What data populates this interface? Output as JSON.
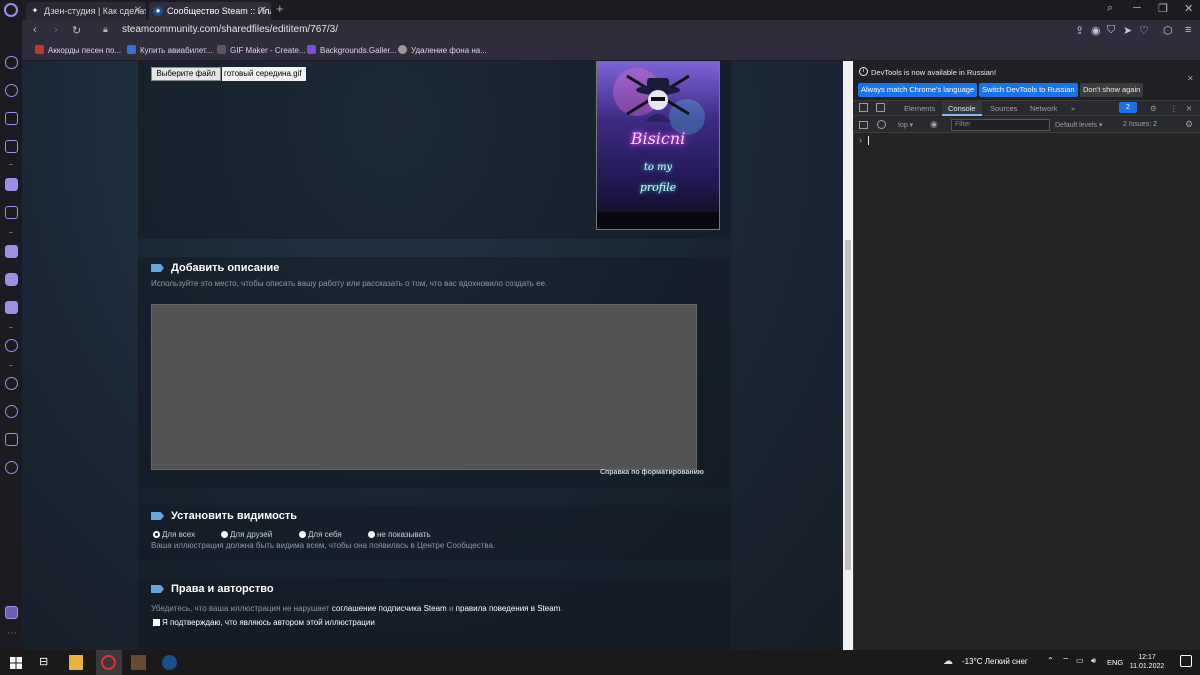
{
  "browser": {
    "tabs": [
      {
        "label": "Дзен-студия | Как сделать"
      },
      {
        "label": "Сообщество Steam :: Илл"
      }
    ],
    "new_tab": "+",
    "address": "steamcommunity.com/sharedfiles/edititem/767/3/",
    "bookmarks": [
      {
        "label": "Аккорды песен по...",
        "color": "#c0392b"
      },
      {
        "label": "Купить авиабилет...",
        "color": "#3b6fd8"
      },
      {
        "label": "GIF Maker - Create...",
        "color": "#5a5a5a"
      },
      {
        "label": "Backgrounds.Galler...",
        "color": "#7b4fd8"
      },
      {
        "label": "Удаление фона на...",
        "color": "#9a9a9a"
      }
    ],
    "accent": "#9b8fe8"
  },
  "page": {
    "file_button": "Выберите файл",
    "file_name": "готовый середина.gif",
    "preview": {
      "line1": "Bisicni",
      "line2": "to my",
      "line3": "profile"
    },
    "description": {
      "title": "Добавить описание",
      "hint": "Используйте это место, чтобы описать вашу работу или рассказать о том, что вас вдохновило создать ее.",
      "format_help": "Справка по форматированию"
    },
    "visibility": {
      "title": "Установить видимость",
      "options": [
        "Для всех",
        "Для друзей",
        "Для себя",
        "не показывать"
      ],
      "selected": "Для всех",
      "note": "Ваша иллюстрация должна быть видима всем, чтобы она появилась в Центре Сообщества."
    },
    "rights": {
      "title": "Права и авторство",
      "text_before": "Убедитесь, что ваша иллюстрация не нарушает",
      "link1": "соглашение подписчика Steam",
      "and": "и",
      "link2": "правила поведения в Steam",
      "period": ".",
      "confirm": "Я подтверждаю, что являюсь автором этой иллюстрации"
    }
  },
  "devtools": {
    "note": "DevTools is now available in Russian!",
    "btn_match": "Always match Chrome's language",
    "btn_switch": "Switch DevTools to Russian",
    "btn_dismiss": "Don't show again",
    "tabs": [
      "Elements",
      "Console",
      "Sources",
      "Network"
    ],
    "active_tab": "Console",
    "more": "»",
    "msg_count": "2",
    "context": "top",
    "filter_placeholder": "Filter",
    "levels": "Default levels",
    "issues": "2 Issues:",
    "issues_count": "2",
    "prompt": "›"
  },
  "taskbar": {
    "weather": "-13°C  Легкий снег",
    "lang": "ENG",
    "time": "12:17",
    "date": "11.01.2022"
  }
}
